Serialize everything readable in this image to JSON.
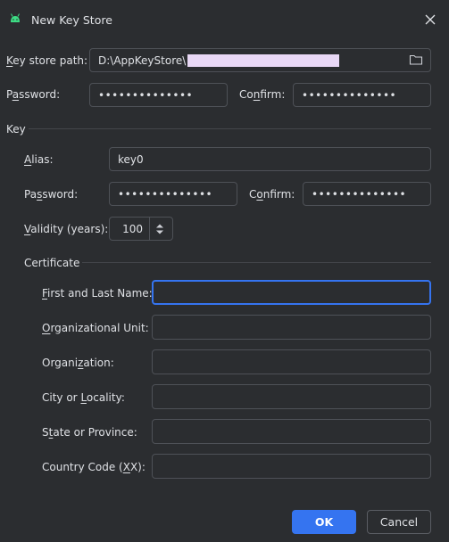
{
  "window": {
    "title": "New Key Store"
  },
  "keystore": {
    "path_label_mn": "K",
    "path_label_rest": "ey store path:",
    "path_value": "D:\\AppKeyStore\\",
    "password_label_pre": "P",
    "password_label_mn": "a",
    "password_label_post": "ssword:",
    "password_value": "••••••••••••••",
    "confirm_label_pre": "Co",
    "confirm_label_mn": "n",
    "confirm_label_post": "firm:",
    "confirm_value": "••••••••••••••"
  },
  "key": {
    "section_label": "Key",
    "alias_label_mn": "A",
    "alias_label_rest": "lias:",
    "alias_value": "key0",
    "password_label_pre": "Pa",
    "password_label_mn": "s",
    "password_label_post": "sword:",
    "password_value": "••••••••••••••",
    "confirm_label_pre": "C",
    "confirm_label_mn": "o",
    "confirm_label_post": "nfirm:",
    "confirm_value": "••••••••••••••",
    "validity_label_mn": "V",
    "validity_label_rest": "alidity (years):",
    "validity_value": "100"
  },
  "certificate": {
    "section_label": "Certificate",
    "first_last_label_mn": "F",
    "first_last_label_rest": "irst and Last Name:",
    "first_last_value": "",
    "org_unit_label_mn": "O",
    "org_unit_label_rest": "rganizational Unit:",
    "org_unit_value": "",
    "org_label_pre": "Organi",
    "org_label_mn": "z",
    "org_label_post": "ation:",
    "org_value": "",
    "city_label_pre": "City or ",
    "city_label_mn": "L",
    "city_label_post": "ocality:",
    "city_value": "",
    "state_label_pre": "S",
    "state_label_mn": "t",
    "state_label_post": "ate or Province:",
    "state_value": "",
    "country_label_pre": "Country Code (",
    "country_label_mn": "X",
    "country_label_post": "X):",
    "country_value": ""
  },
  "buttons": {
    "ok": "OK",
    "cancel": "Cancel"
  },
  "icons": {
    "app": "android-icon",
    "close": "close-icon",
    "folder": "folder-icon",
    "spinner": "spinner-arrows-icon"
  },
  "colors": {
    "background": "#2b2d30",
    "accent": "#3574f0",
    "border": "#4e5157",
    "text": "#dfe1e5"
  }
}
